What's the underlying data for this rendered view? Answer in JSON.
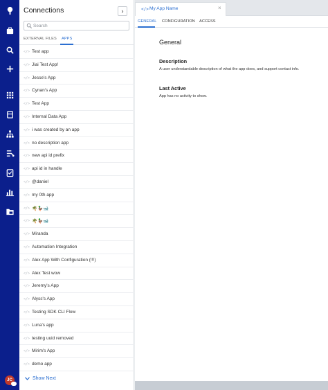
{
  "rail": {
    "icons": [
      "logo-icon",
      "briefcase-icon",
      "search-icon",
      "plus-icon",
      "grid-icon",
      "database-icon",
      "hierarchy-icon",
      "flow-icon",
      "checklist-icon",
      "chart-icon",
      "folder-icon"
    ],
    "avatar_initials": "JC"
  },
  "panel": {
    "title": "Connections",
    "collapse_glyph": "›",
    "search_placeholder": "Search",
    "tabs": [
      "EXTERNAL FILES",
      "APPS"
    ],
    "active_tab": "APPS",
    "items": [
      "Test app",
      "Jiai Test App!",
      "Jesse's App",
      "Cynan's App",
      "Test App",
      "Internal Data App",
      "i was created by an app",
      "no description app",
      "new api id prefix",
      "api id in handle",
      "@daniel",
      "my 0th app",
      "🌴🦆🐋",
      "🌴🦆🐋",
      "Miranda",
      "Automation Integration",
      "Alex App With Configuration (!!!)",
      "Alex Test wow",
      "Jeremy's App",
      "Alyss's App",
      "Testing SDK CLI Flow",
      "Luna's app",
      "testing uuid removed",
      "Mirim's App",
      "demo app"
    ],
    "show_next": "Show Next"
  },
  "doc_tab": {
    "icon": "</>",
    "title": "My App Name",
    "close": "×"
  },
  "subtabs": [
    "GENERAL",
    "CONFIGURATION",
    "ACCESS"
  ],
  "content": {
    "section_title": "General",
    "description_heading": "Description",
    "description_text": "A user understandable description of what the app does, and support contact info.",
    "last_active_heading": "Last Active",
    "last_active_text": "App has no activity to show."
  },
  "colors": {
    "rail": "#0b1f8c",
    "accent": "#2b6fd1"
  }
}
